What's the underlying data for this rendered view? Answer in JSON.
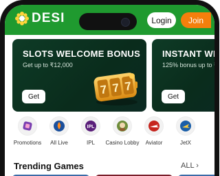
{
  "brand": {
    "name": "DESI"
  },
  "header": {
    "login_label": "Login",
    "join_label": "Join"
  },
  "banners": [
    {
      "title": "SLOTS WELCOME BONUS",
      "subtitle": "Get up to ₹12,000",
      "cta": "Get"
    },
    {
      "title": "INSTANT WE",
      "subtitle": "125% bonus up to ₹",
      "cta": "Get"
    }
  ],
  "games": [
    {
      "label": "Promotions",
      "icon": "promotions-icon"
    },
    {
      "label": "All Live",
      "icon": "all-live-icon"
    },
    {
      "label": "IPL",
      "icon": "ipl-icon"
    },
    {
      "label": "Casino Lobby",
      "icon": "casino-lobby-icon"
    },
    {
      "label": "Aviator",
      "icon": "aviator-icon"
    },
    {
      "label": "JetX",
      "icon": "jetx-icon"
    }
  ],
  "trending": {
    "title": "Trending Games",
    "all_label": "ALL ›"
  },
  "colors": {
    "header_green": "#1f9a2f",
    "join_orange": "#f57f0c",
    "banner_dark": "#0e3b26"
  }
}
